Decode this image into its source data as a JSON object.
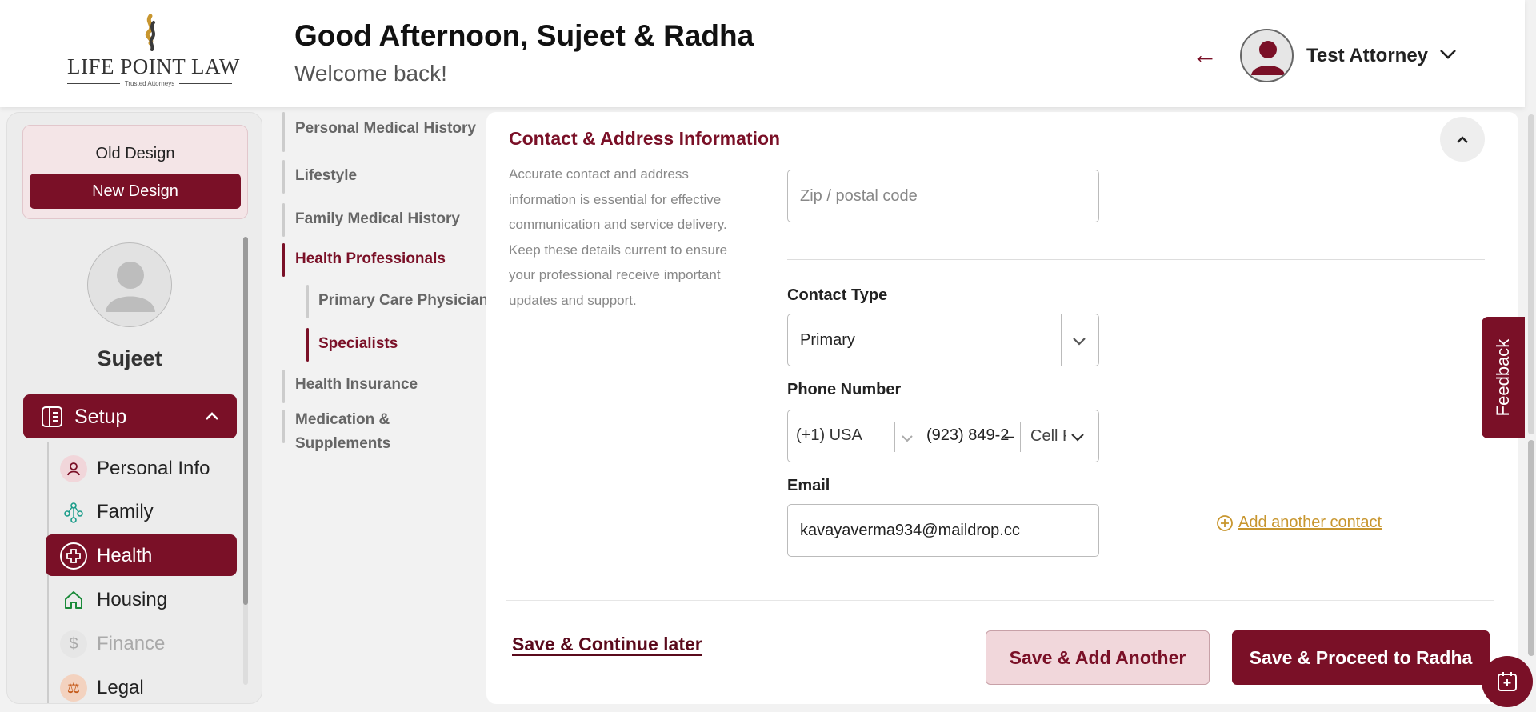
{
  "header": {
    "logo_text": "LIFE POINT LAW",
    "logo_tagline": "Trusted Attorneys",
    "greeting": "Good Afternoon, Sujeet & Radha",
    "welcome": "Welcome back!",
    "user_name": "Test Attorney"
  },
  "sidebar": {
    "old_design": "Old Design",
    "new_design": "New Design",
    "profile_name": "Sujeet",
    "setup_label": "Setup",
    "items": [
      {
        "label": "Personal Info",
        "icon": "person-icon"
      },
      {
        "label": "Family",
        "icon": "family-icon"
      },
      {
        "label": "Health",
        "icon": "health-cross-icon"
      },
      {
        "label": "Housing",
        "icon": "house-icon"
      },
      {
        "label": "Finance",
        "icon": "dollar-icon"
      },
      {
        "label": "Legal",
        "icon": "legal-icon"
      }
    ]
  },
  "subnav": {
    "personal_medical_history": "Personal Medical History",
    "lifestyle": "Lifestyle",
    "family_medical_history": "Family Medical History",
    "health_professionals": "Health Professionals",
    "primary_care_physician": "Primary Care Physician",
    "specialists": "Specialists",
    "health_insurance": "Health Insurance",
    "medication_line1": "Medication &",
    "medication_line2": "Supplements"
  },
  "main": {
    "section_title": "Contact & Address Information",
    "section_desc": "Accurate contact and address information is essential for effective communication and service delivery. Keep these details current to ensure your professional receive important updates and support.",
    "zip_placeholder": "Zip / postal code",
    "contact_type_label": "Contact Type",
    "contact_type_value": "Primary",
    "phone_label": "Phone Number",
    "phone_country": "(+1) USA",
    "phone_number": "(923) 849-2̶",
    "phone_type": "Cell Phone",
    "email_label": "Email",
    "email_value": "kavayaverma934@maildrop.cc",
    "add_contact": "Add another contact",
    "save_later": "Save & Continue later",
    "save_add_another": "Save & Add Another",
    "save_proceed": "Save & Proceed to Radha"
  },
  "feedback": "Feedback",
  "colors": {
    "brand": "#7a1027",
    "accent_gold": "#c8962f",
    "background": "#f2f2f2"
  }
}
